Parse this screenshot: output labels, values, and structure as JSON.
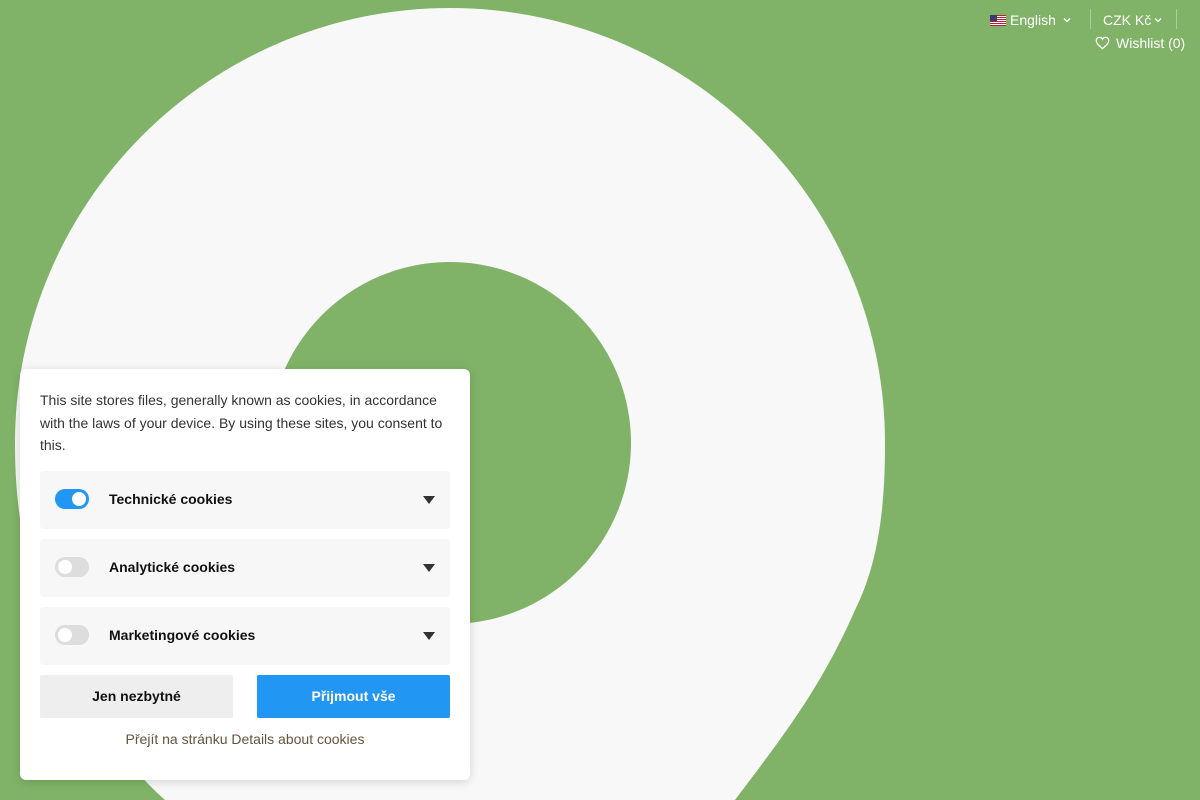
{
  "colors": {
    "background": "#80b368",
    "shape": "#f8f8f8",
    "accent": "#2196f3"
  },
  "header": {
    "language_label": "English",
    "language_flag": "us-flag-icon",
    "currency_label": "CZK Kč",
    "wishlist_label": "Wishlist (0)",
    "wishlist_icon": "heart-icon"
  },
  "cookie_consent": {
    "message": "This site stores files, generally known as cookies, in accordance with the laws of your device. By using these sites, you consent to this.",
    "categories": [
      {
        "label": "Technické cookies",
        "enabled": true
      },
      {
        "label": "Analytické cookies",
        "enabled": false
      },
      {
        "label": "Marketingové cookies",
        "enabled": false
      }
    ],
    "necessary_button": "Jen nezbytné",
    "accept_button": "Přijmout vše",
    "details_link": "Přejít na stránku Details about cookies"
  }
}
